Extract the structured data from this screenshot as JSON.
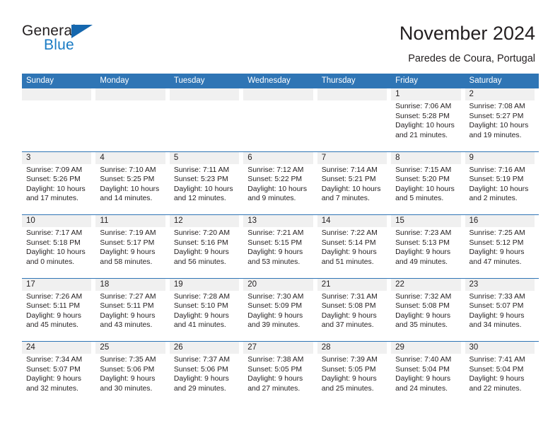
{
  "brand": {
    "word1": "General",
    "word2": "Blue",
    "triangle_color": "#1567ae",
    "blue_text_color": "#1a7bc4"
  },
  "header": {
    "title": "November 2024",
    "subtitle": "Paredes de Coura, Portugal",
    "accent_color": "#2f75b5",
    "day_strip_color": "#f0f0f0"
  },
  "weekdays": [
    "Sunday",
    "Monday",
    "Tuesday",
    "Wednesday",
    "Thursday",
    "Friday",
    "Saturday"
  ],
  "weeks": [
    [
      {
        "day": "",
        "sunrise": "",
        "sunset": "",
        "daylight1": "",
        "daylight2": "",
        "empty": true
      },
      {
        "day": "",
        "sunrise": "",
        "sunset": "",
        "daylight1": "",
        "daylight2": "",
        "empty": true
      },
      {
        "day": "",
        "sunrise": "",
        "sunset": "",
        "daylight1": "",
        "daylight2": "",
        "empty": true
      },
      {
        "day": "",
        "sunrise": "",
        "sunset": "",
        "daylight1": "",
        "daylight2": "",
        "empty": true
      },
      {
        "day": "",
        "sunrise": "",
        "sunset": "",
        "daylight1": "",
        "daylight2": "",
        "empty": true
      },
      {
        "day": "1",
        "sunrise": "Sunrise: 7:06 AM",
        "sunset": "Sunset: 5:28 PM",
        "daylight1": "Daylight: 10 hours",
        "daylight2": "and 21 minutes."
      },
      {
        "day": "2",
        "sunrise": "Sunrise: 7:08 AM",
        "sunset": "Sunset: 5:27 PM",
        "daylight1": "Daylight: 10 hours",
        "daylight2": "and 19 minutes."
      }
    ],
    [
      {
        "day": "3",
        "sunrise": "Sunrise: 7:09 AM",
        "sunset": "Sunset: 5:26 PM",
        "daylight1": "Daylight: 10 hours",
        "daylight2": "and 17 minutes."
      },
      {
        "day": "4",
        "sunrise": "Sunrise: 7:10 AM",
        "sunset": "Sunset: 5:25 PM",
        "daylight1": "Daylight: 10 hours",
        "daylight2": "and 14 minutes."
      },
      {
        "day": "5",
        "sunrise": "Sunrise: 7:11 AM",
        "sunset": "Sunset: 5:23 PM",
        "daylight1": "Daylight: 10 hours",
        "daylight2": "and 12 minutes."
      },
      {
        "day": "6",
        "sunrise": "Sunrise: 7:12 AM",
        "sunset": "Sunset: 5:22 PM",
        "daylight1": "Daylight: 10 hours",
        "daylight2": "and 9 minutes."
      },
      {
        "day": "7",
        "sunrise": "Sunrise: 7:14 AM",
        "sunset": "Sunset: 5:21 PM",
        "daylight1": "Daylight: 10 hours",
        "daylight2": "and 7 minutes."
      },
      {
        "day": "8",
        "sunrise": "Sunrise: 7:15 AM",
        "sunset": "Sunset: 5:20 PM",
        "daylight1": "Daylight: 10 hours",
        "daylight2": "and 5 minutes."
      },
      {
        "day": "9",
        "sunrise": "Sunrise: 7:16 AM",
        "sunset": "Sunset: 5:19 PM",
        "daylight1": "Daylight: 10 hours",
        "daylight2": "and 2 minutes."
      }
    ],
    [
      {
        "day": "10",
        "sunrise": "Sunrise: 7:17 AM",
        "sunset": "Sunset: 5:18 PM",
        "daylight1": "Daylight: 10 hours",
        "daylight2": "and 0 minutes."
      },
      {
        "day": "11",
        "sunrise": "Sunrise: 7:19 AM",
        "sunset": "Sunset: 5:17 PM",
        "daylight1": "Daylight: 9 hours",
        "daylight2": "and 58 minutes."
      },
      {
        "day": "12",
        "sunrise": "Sunrise: 7:20 AM",
        "sunset": "Sunset: 5:16 PM",
        "daylight1": "Daylight: 9 hours",
        "daylight2": "and 56 minutes."
      },
      {
        "day": "13",
        "sunrise": "Sunrise: 7:21 AM",
        "sunset": "Sunset: 5:15 PM",
        "daylight1": "Daylight: 9 hours",
        "daylight2": "and 53 minutes."
      },
      {
        "day": "14",
        "sunrise": "Sunrise: 7:22 AM",
        "sunset": "Sunset: 5:14 PM",
        "daylight1": "Daylight: 9 hours",
        "daylight2": "and 51 minutes."
      },
      {
        "day": "15",
        "sunrise": "Sunrise: 7:23 AM",
        "sunset": "Sunset: 5:13 PM",
        "daylight1": "Daylight: 9 hours",
        "daylight2": "and 49 minutes."
      },
      {
        "day": "16",
        "sunrise": "Sunrise: 7:25 AM",
        "sunset": "Sunset: 5:12 PM",
        "daylight1": "Daylight: 9 hours",
        "daylight2": "and 47 minutes."
      }
    ],
    [
      {
        "day": "17",
        "sunrise": "Sunrise: 7:26 AM",
        "sunset": "Sunset: 5:11 PM",
        "daylight1": "Daylight: 9 hours",
        "daylight2": "and 45 minutes."
      },
      {
        "day": "18",
        "sunrise": "Sunrise: 7:27 AM",
        "sunset": "Sunset: 5:11 PM",
        "daylight1": "Daylight: 9 hours",
        "daylight2": "and 43 minutes."
      },
      {
        "day": "19",
        "sunrise": "Sunrise: 7:28 AM",
        "sunset": "Sunset: 5:10 PM",
        "daylight1": "Daylight: 9 hours",
        "daylight2": "and 41 minutes."
      },
      {
        "day": "20",
        "sunrise": "Sunrise: 7:30 AM",
        "sunset": "Sunset: 5:09 PM",
        "daylight1": "Daylight: 9 hours",
        "daylight2": "and 39 minutes."
      },
      {
        "day": "21",
        "sunrise": "Sunrise: 7:31 AM",
        "sunset": "Sunset: 5:08 PM",
        "daylight1": "Daylight: 9 hours",
        "daylight2": "and 37 minutes."
      },
      {
        "day": "22",
        "sunrise": "Sunrise: 7:32 AM",
        "sunset": "Sunset: 5:08 PM",
        "daylight1": "Daylight: 9 hours",
        "daylight2": "and 35 minutes."
      },
      {
        "day": "23",
        "sunrise": "Sunrise: 7:33 AM",
        "sunset": "Sunset: 5:07 PM",
        "daylight1": "Daylight: 9 hours",
        "daylight2": "and 34 minutes."
      }
    ],
    [
      {
        "day": "24",
        "sunrise": "Sunrise: 7:34 AM",
        "sunset": "Sunset: 5:07 PM",
        "daylight1": "Daylight: 9 hours",
        "daylight2": "and 32 minutes."
      },
      {
        "day": "25",
        "sunrise": "Sunrise: 7:35 AM",
        "sunset": "Sunset: 5:06 PM",
        "daylight1": "Daylight: 9 hours",
        "daylight2": "and 30 minutes."
      },
      {
        "day": "26",
        "sunrise": "Sunrise: 7:37 AM",
        "sunset": "Sunset: 5:06 PM",
        "daylight1": "Daylight: 9 hours",
        "daylight2": "and 29 minutes."
      },
      {
        "day": "27",
        "sunrise": "Sunrise: 7:38 AM",
        "sunset": "Sunset: 5:05 PM",
        "daylight1": "Daylight: 9 hours",
        "daylight2": "and 27 minutes."
      },
      {
        "day": "28",
        "sunrise": "Sunrise: 7:39 AM",
        "sunset": "Sunset: 5:05 PM",
        "daylight1": "Daylight: 9 hours",
        "daylight2": "and 25 minutes."
      },
      {
        "day": "29",
        "sunrise": "Sunrise: 7:40 AM",
        "sunset": "Sunset: 5:04 PM",
        "daylight1": "Daylight: 9 hours",
        "daylight2": "and 24 minutes."
      },
      {
        "day": "30",
        "sunrise": "Sunrise: 7:41 AM",
        "sunset": "Sunset: 5:04 PM",
        "daylight1": "Daylight: 9 hours",
        "daylight2": "and 22 minutes."
      }
    ]
  ]
}
